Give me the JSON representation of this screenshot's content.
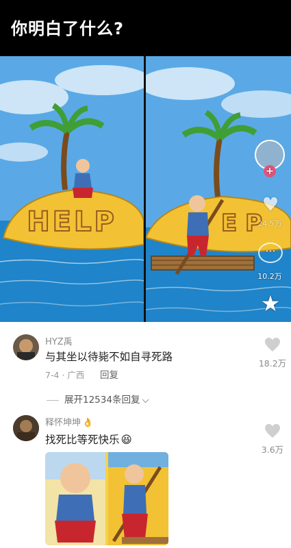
{
  "header": {
    "title": "你明白了什么?"
  },
  "comic": {
    "help_sign": "HELP",
    "right_sign": "E  P",
    "side": {
      "likes": "24.5万",
      "comments": "10.2万"
    }
  },
  "comments": [
    {
      "username": "HYZ禹",
      "text": "与其坐以待毙不如自寻死路",
      "date": "7-4 · 广西",
      "reply": "回复",
      "likes": "18.2万"
    },
    {
      "username": "释怀坤坤",
      "text": "找死比等死快乐",
      "likes": "3.6万"
    }
  ],
  "expand_replies": "展开12534条回复",
  "icons": {
    "like": "heart-icon",
    "expand": "chevron-down-icon",
    "more": "more-dots-icon",
    "favorite": "star-icon",
    "add": "plus-icon",
    "emoji": "grinning-emoji-icon",
    "badge": "hand-emoji-icon"
  },
  "colors": {
    "header_bg": "#000000",
    "sky": "#5aa9e6",
    "sea": "#1f84c9",
    "island": "#f2c234"
  }
}
